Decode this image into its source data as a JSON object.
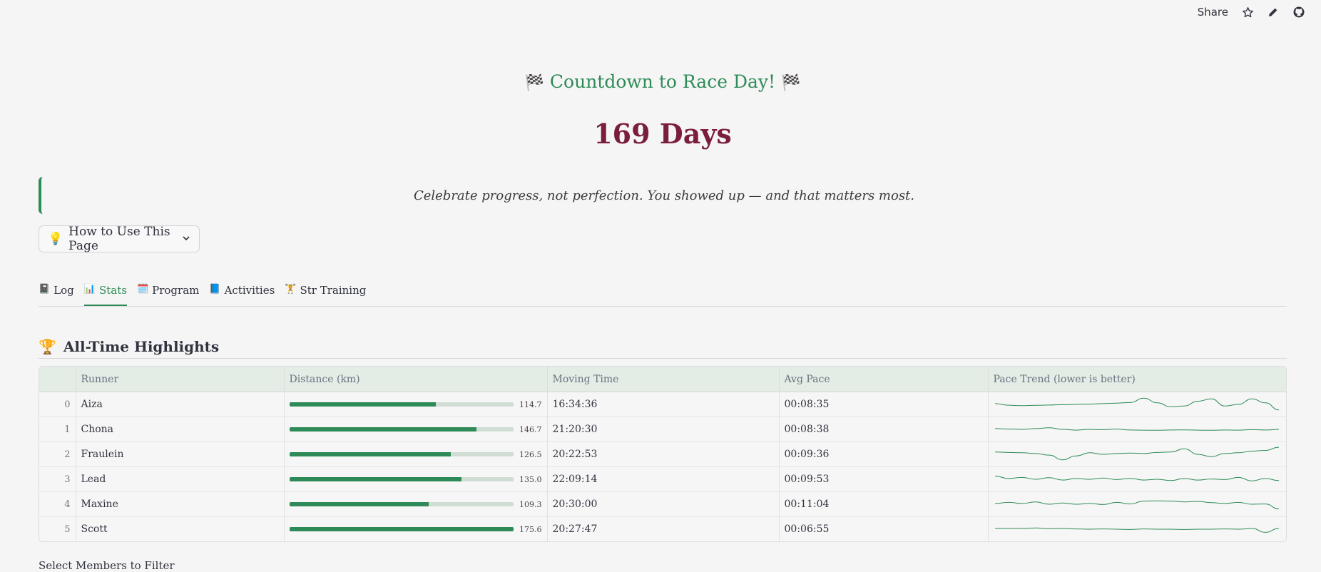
{
  "topbar": {
    "share_label": "Share",
    "icons": [
      "star-icon",
      "pencil-icon",
      "github-icon"
    ]
  },
  "header": {
    "title": "Countdown to Race Day!",
    "flag_glyph": "🏁",
    "days": "169 Days",
    "quote": "Celebrate progress, not perfection. You showed up — and that matters most."
  },
  "howto": {
    "icon": "💡",
    "label": "How to Use This Page"
  },
  "tabs": [
    {
      "icon": "📓",
      "label": "Log",
      "active": false
    },
    {
      "icon": "📊",
      "label": "Stats",
      "active": true
    },
    {
      "icon": "🗓️",
      "label": "Program",
      "active": false
    },
    {
      "icon": "📘",
      "label": "Activities",
      "active": false
    },
    {
      "icon": "🏋️",
      "label": "Str Training",
      "active": false
    }
  ],
  "section": {
    "icon": "🏆",
    "title": "All-Time Highlights"
  },
  "table": {
    "columns": [
      "",
      "Runner",
      "Distance (km)",
      "Moving Time",
      "Avg Pace",
      "Pace Trend (lower is better)"
    ],
    "distance_max": 175.6,
    "accent": "#2e8b57",
    "rows": [
      {
        "index": "0",
        "runner": "Aiza",
        "distance": "114.7",
        "moving_time": "16:34:36",
        "avg_pace": "00:08:35",
        "trend": [
          0.55,
          0.45,
          0.42,
          0.44,
          0.46,
          0.48,
          0.5,
          0.52,
          0.55,
          0.58,
          0.62,
          0.9,
          0.6,
          0.35,
          0.4,
          0.7,
          0.85,
          0.4,
          0.5,
          0.85,
          0.6,
          0.15
        ]
      },
      {
        "index": "1",
        "runner": "Chona",
        "distance": "146.7",
        "moving_time": "21:20:30",
        "avg_pace": "00:08:38",
        "trend": [
          0.55,
          0.52,
          0.5,
          0.55,
          0.6,
          0.5,
          0.45,
          0.5,
          0.48,
          0.52,
          0.46,
          0.45,
          0.44,
          0.46,
          0.47,
          0.45,
          0.44,
          0.46,
          0.45,
          0.48,
          0.46,
          0.5
        ]
      },
      {
        "index": "2",
        "runner": "Fraulein",
        "distance": "126.5",
        "moving_time": "20:22:53",
        "avg_pace": "00:09:36",
        "trend": [
          0.65,
          0.62,
          0.6,
          0.55,
          0.45,
          0.15,
          0.4,
          0.6,
          0.5,
          0.55,
          0.58,
          0.55,
          0.62,
          0.65,
          0.85,
          0.5,
          0.35,
          0.55,
          0.6,
          0.7,
          0.75,
          0.95
        ]
      },
      {
        "index": "3",
        "runner": "Lead",
        "distance": "135.0",
        "moving_time": "22:09:14",
        "avg_pace": "00:09:53",
        "trend": [
          0.7,
          0.55,
          0.62,
          0.5,
          0.6,
          0.45,
          0.55,
          0.5,
          0.58,
          0.48,
          0.56,
          0.45,
          0.5,
          0.42,
          0.55,
          0.45,
          0.52,
          0.48,
          0.62,
          0.4,
          0.55,
          0.42
        ]
      },
      {
        "index": "4",
        "runner": "Maxine",
        "distance": "109.3",
        "moving_time": "20:30:00",
        "avg_pace": "00:11:04",
        "trend": [
          0.55,
          0.62,
          0.55,
          0.65,
          0.5,
          0.58,
          0.5,
          0.55,
          0.48,
          0.62,
          0.52,
          0.7,
          0.72,
          0.7,
          0.65,
          0.68,
          0.6,
          0.55,
          0.62,
          0.5,
          0.52,
          0.2
        ]
      },
      {
        "index": "5",
        "runner": "Scott",
        "distance": "175.6",
        "moving_time": "20:27:47",
        "avg_pace": "00:06:55",
        "trend": [
          0.55,
          0.55,
          0.56,
          0.58,
          0.54,
          0.55,
          0.52,
          0.5,
          0.52,
          0.5,
          0.48,
          0.52,
          0.5,
          0.5,
          0.48,
          0.5,
          0.5,
          0.52,
          0.5,
          0.55,
          0.3,
          0.55
        ]
      }
    ]
  },
  "footer_peek": "Select Members to Filter"
}
